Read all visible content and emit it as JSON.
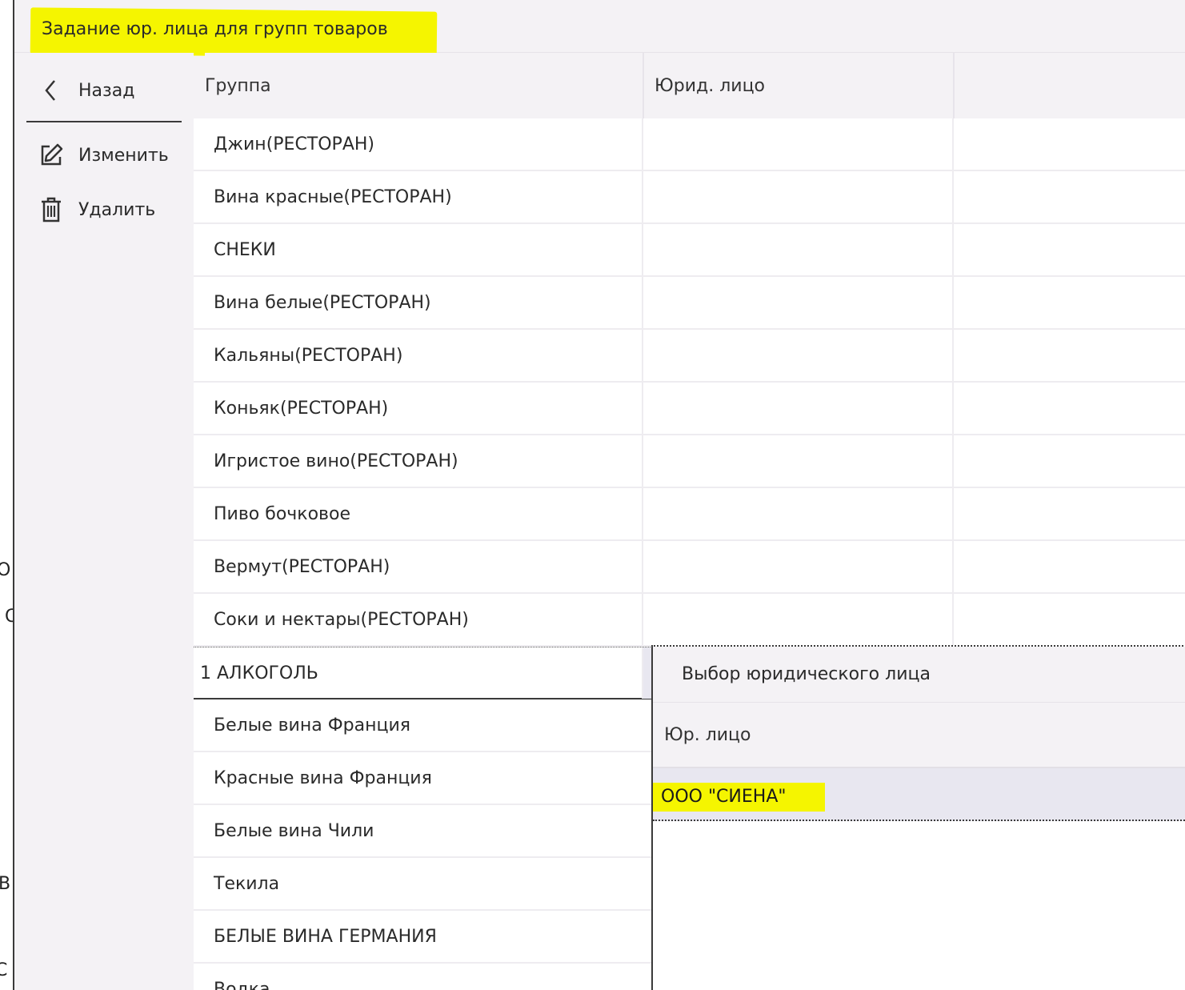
{
  "window": {
    "title": "Задание юр. лица для групп товаров"
  },
  "sidebar": {
    "back_label": "Назад",
    "edit_label": "Изменить",
    "delete_label": "Удалить"
  },
  "table": {
    "columns": [
      "Группа",
      "Юрид. лицо",
      ""
    ],
    "rows": [
      "Джин(РЕСТОРАН)",
      "Вина красные(РЕСТОРАН)",
      "СНЕКИ",
      "Вина белые(РЕСТОРАН)",
      "Кальяны(РЕСТОРАН)",
      "Коньяк(РЕСТОРАН)",
      "Игристое вино(РЕСТОРАН)",
      "Пиво бочковое",
      "Вермут(РЕСТОРАН)",
      "Соки и нектары(РЕСТОРАН)",
      "1 АЛКОГОЛЬ",
      "Белые вина Франция",
      "Красные вина Франция",
      "Белые вина Чили",
      "Текила",
      "БЕЛЫЕ ВИНА ГЕРМАНИЯ",
      "Водка"
    ],
    "selected_row": "1 АЛКОГОЛЬ"
  },
  "popup": {
    "title": "Выбор юридического лица",
    "column_header": "Юр. лицо",
    "options": [
      "ООО \"СИЕНА\""
    ]
  },
  "background_fragments": [
    "О",
    "С",
    "В",
    "С"
  ],
  "colors": {
    "highlight": "#f5f500",
    "panel_bg": "#f4f2f5",
    "selected_row_bg": "#e8e7f0"
  }
}
